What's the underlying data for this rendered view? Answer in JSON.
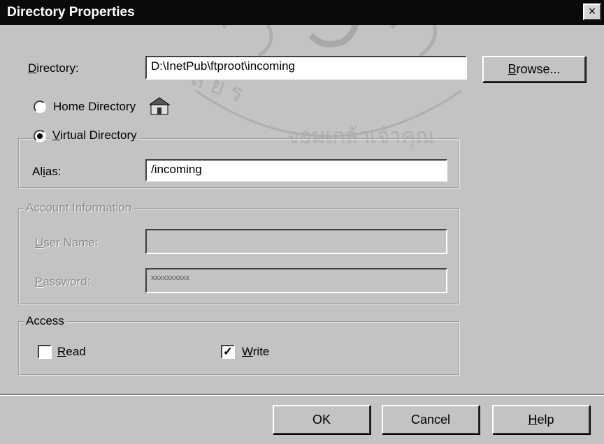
{
  "window": {
    "title": "Directory Properties",
    "close_glyph": "×"
  },
  "directory": {
    "label_prefix": "",
    "label_key": "D",
    "label_rest": "irectory:",
    "value": "D:\\InetPub\\ftproot\\incoming"
  },
  "browse_button": {
    "key": "B",
    "rest": "rowse..."
  },
  "home_directory": {
    "label": "Home Directory",
    "icon": "home-icon",
    "selected": false
  },
  "virtual_directory": {
    "key": "V",
    "rest": "irtual Directory",
    "selected": true
  },
  "alias": {
    "pre": "Al",
    "key": "i",
    "post": "as:",
    "value": "/incoming"
  },
  "account": {
    "title": "Account Information",
    "username_key": "U",
    "username_rest": "ser Name:",
    "username_value": "",
    "password_key": "P",
    "password_rest": "assword:",
    "password_value": "xxxxxxxxxx"
  },
  "access": {
    "title": "Access",
    "read": {
      "key": "R",
      "rest": "ead",
      "checked": false
    },
    "write": {
      "key": "W",
      "rest": "rite",
      "checked": true
    }
  },
  "buttons": {
    "ok": "OK",
    "cancel": "Cancel",
    "help_key": "H",
    "help_rest": "elp"
  },
  "colors": {
    "dialog_bg": "#c3c3c3",
    "titlebar_bg": "#0a0a0a"
  }
}
